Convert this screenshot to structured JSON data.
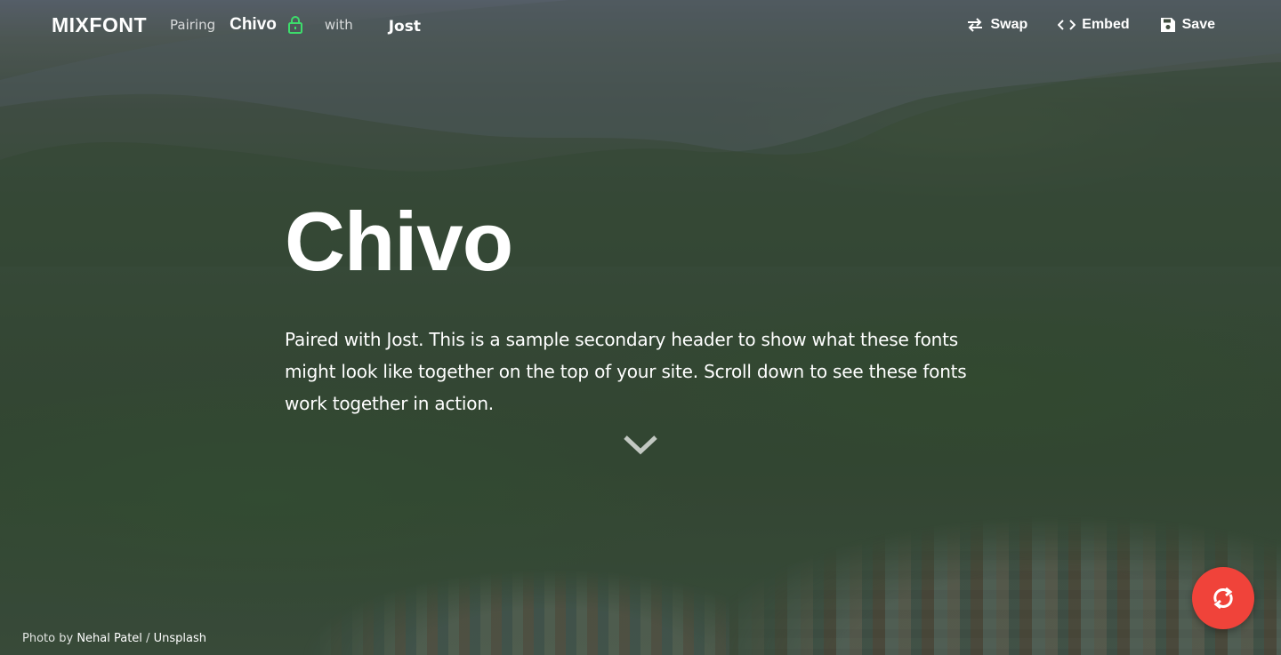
{
  "nav": {
    "brand": "MIXFONT",
    "pairing_label": "Pairing",
    "primary_font": "Chivo",
    "with_label": "with",
    "secondary_font": "Jost",
    "lock_color": "#3ddc6b",
    "actions": [
      {
        "label": "Swap",
        "icon": "swap-icon"
      },
      {
        "label": "Embed",
        "icon": "code-icon"
      },
      {
        "label": "Save",
        "icon": "floppy-disk-icon"
      }
    ]
  },
  "hero": {
    "headline": "Chivo",
    "subtext": "Paired with Jost. This is a sample secondary header to show what these fonts might look like together on the top of your site. Scroll down to see these fonts work together in action.",
    "scroll_icon": "chevron-down-icon"
  },
  "credit": {
    "prefix": "Photo by",
    "author": "Nehal Patel",
    "separator": "/",
    "source": "Unsplash"
  },
  "fab": {
    "icon": "refresh-icon",
    "color": "#f0433a"
  }
}
